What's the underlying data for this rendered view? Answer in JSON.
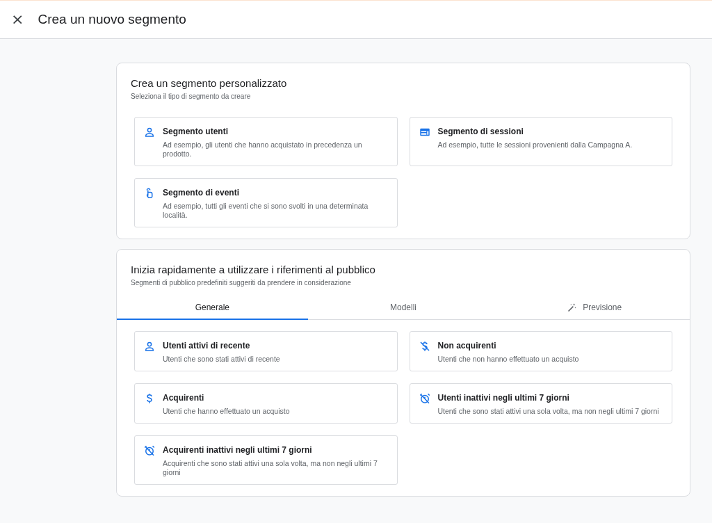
{
  "header": {
    "close_icon": "×",
    "title": "Crea un nuovo segmento"
  },
  "custom_panel": {
    "title": "Crea un segmento personalizzato",
    "subtitle": "Seleziona il tipo di segmento da creare",
    "cards": [
      {
        "kind": "person",
        "title": "Segmento utenti",
        "description": "Ad esempio, gli utenti che hanno acquistato in precedenza un prodotto."
      },
      {
        "kind": "session",
        "title": "Segmento di sessioni",
        "description": "Ad esempio, tutte le sessioni provenienti dalla Campagna A."
      },
      {
        "kind": "touch",
        "title": "Segmento di eventi",
        "description": "Ad esempio, tutti gli eventi che si sono svolti in una determinata località."
      }
    ]
  },
  "audience_panel": {
    "title": "Inizia rapidamente a utilizzare i riferimenti al pubblico",
    "subtitle": "Segmenti di pubblico predefiniti suggeriti da prendere in considerazione",
    "tabs": [
      {
        "label": "Generale",
        "selected": true
      },
      {
        "label": "Modelli",
        "selected": false
      },
      {
        "label": "Previsione",
        "selected": false,
        "kind": "wand"
      }
    ],
    "cards": [
      {
        "kind": "person",
        "title": "Utenti attivi di recente",
        "description": "Utenti che sono stati attivi di recente"
      },
      {
        "kind": "dollar-off",
        "title": "Non acquirenti",
        "description": "Utenti che non hanno effettuato un acquisto"
      },
      {
        "kind": "dollar",
        "title": "Acquirenti",
        "description": "Utenti che hanno effettuato un acquisto"
      },
      {
        "kind": "alarm-off",
        "title": "Utenti inattivi negli ultimi 7 giorni",
        "description": "Utenti che sono stati attivi una sola volta, ma non negli ultimi 7 giorni"
      },
      {
        "kind": "alarm-off",
        "title": "Acquirenti inattivi negli ultimi 7 giorni",
        "description": "Acquirenti che sono stati attivi una sola volta, ma non negli ultimi 7 giorni"
      }
    ]
  }
}
